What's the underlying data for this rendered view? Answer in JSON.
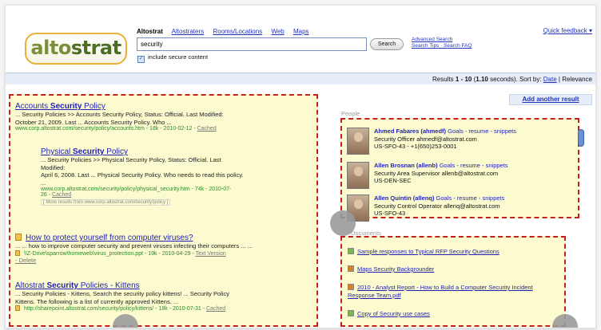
{
  "header": {
    "logo_part1": "alto",
    "logo_part2": "strat",
    "nav": [
      "Altostrat",
      "Altostraters",
      "Rooms/Locations",
      "Web",
      "Maps"
    ],
    "quick_feedback": "Quick feedback ▾"
  },
  "search": {
    "value": "security",
    "button_label": "Search",
    "advanced_link": "Advanced Search",
    "tips_link": "Search Tips · Search FAQ",
    "include_secure_label": "include secure content"
  },
  "results_bar": {
    "prefix": "Results ",
    "range": "1 - 10",
    "of_text": " (",
    "seconds": "1.10",
    "seconds_suffix": " seconds). Sort by: ",
    "sort_date": "Date",
    "separator": " | Relevance"
  },
  "add_result": "Add another result",
  "results": [
    {
      "title_pre": "Accounts ",
      "title_bold": "Security",
      "title_post": " Policy",
      "snippet_line1": "... Security Policies >> Accounts Security Policy, Status: Official. Last Modified:",
      "snippet_line2": "October 21, 2009. Last ... Accounts Security Policy. Who ...",
      "url": "www.corp.altostrat.com/security/policy/accounts.htm - 18k - 2010-02-12 - ",
      "cached": "Cached"
    },
    {
      "title_pre": "Physical ",
      "title_bold": "Security",
      "title_post": " Policy",
      "snippet_line1": "... Security Policies >> Physical Security Policy, Status: Official. Last",
      "snippet_line2": "Modified:",
      "snippet_line3": "April 6, 2008. Last ... Physical Security Policy. Who needs to read this policy.",
      "snippet_line4": "...",
      "url_line1": "www.corp.altostrat.com/security/policy/physical_security.htm - 74k - 2010-07-",
      "url_line2": "26 - ",
      "cached": "Cached",
      "more": "[ More results from www.corp.altostrat.com/security/policy ]"
    },
    {
      "title": "How to protect yourself from computer viruses?",
      "snippet_line1": "... ... how to improve computer security and prevent viruses infecting their computers ... ...",
      "url": "\\\\Z-Drive\\sparrow\\homeweb\\virus_protection.ppt - 19k - 2010-04-29 - ",
      "text_version": "Text Version",
      "extra": "- Delete"
    },
    {
      "title_pre": "Altostrat ",
      "title_bold": "Security",
      "title_post": " Policies - Kittens",
      "snippet_line1": "... Security Policies - Kittens, Search the security policy kittens! ... Security Policy",
      "snippet_line2": "Kittens. The following is a list of currently approved Kittens. ...",
      "url": "http://sharepoint.altostrat.com/security/policy/kittens/ - 18k - 2010-07-31 - ",
      "cached": "Cached"
    }
  ],
  "people_label": "People",
  "people": [
    {
      "name": "Ahmed Fabares (ahmedf)",
      "links": "Goals - resume - snippets",
      "line2": "Security Officer ahmedf@altostrat.com",
      "line3": "US-SFO-43 - +1(650)253-0001"
    },
    {
      "name": "Allen Brosnan (allenb)",
      "links": "Goals - resume - snippets",
      "line2": "Security Area Supervisor allenb@altostrat.com",
      "line3": "US-DEN-SEC"
    },
    {
      "name": "Allen Quintin (allenq)",
      "links": "Goals - resume - snippets",
      "line2": "Security Control Operator allenq@altostrat.com",
      "line3": "US-SFO-43"
    }
  ],
  "documents_label": "Documents",
  "documents": [
    {
      "title": "Sample responses to Typical RFP Security Questions",
      "icon": "spreadsheet-icon",
      "icon_color": "#7ab648"
    },
    {
      "title": "Maps Security Backgrounder",
      "icon": "document-icon",
      "icon_color": "#d9822b"
    },
    {
      "title": "2010 - Analyst Report - How to Build a Computer Security Incident",
      "title_line2": "Response Team.pdf",
      "icon": "pdf-icon",
      "icon_color": "#d9822b"
    },
    {
      "title": "Copy of Security use cases",
      "icon": "spreadsheet-icon",
      "icon_color": "#7ab648"
    }
  ],
  "colors": {
    "highlight_fill": "#fbfbcf",
    "highlight_border": "#c81e1e",
    "link": "#1f1fb5",
    "url_green": "#2a8a2a"
  }
}
